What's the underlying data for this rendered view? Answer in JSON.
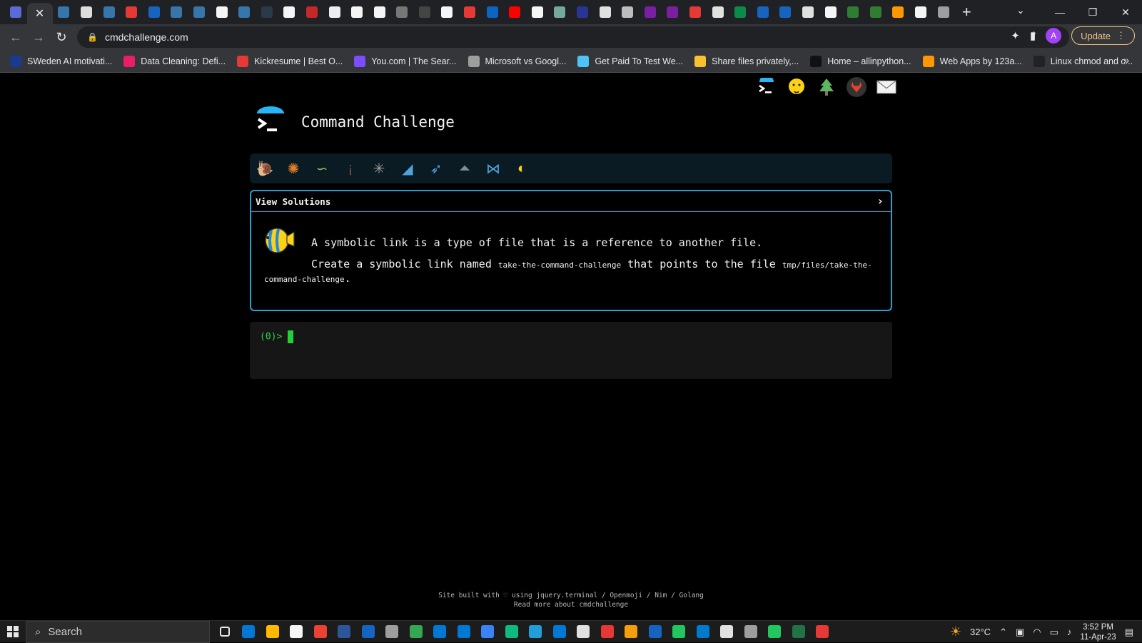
{
  "browser": {
    "url": "cmdchallenge.com",
    "update_label": "Update",
    "avatar_initial": "A",
    "tab_favicons": [
      "#5b6bd6",
      "#3776ab",
      "#dddddd",
      "#3776ab",
      "#e53935",
      "#1565c0",
      "#3776ab",
      "#3776ab",
      "#f5f5f5",
      "#3776ab",
      "#2a3a4a",
      "#f5f5f5",
      "#c62828",
      "#eeeeee",
      "#f5f5f5",
      "#f5f5f5",
      "#777777",
      "#444444",
      "#f5f5f5",
      "#e53935",
      "#0a66c2",
      "#ff0000",
      "#f5f5f5",
      "#74aa9c",
      "#283593",
      "#e0e0e0",
      "#bdbdbd",
      "#7b1fa2",
      "#7b1fa2",
      "#e53935",
      "#e0e0e0",
      "#0b8a4a",
      "#1565c0",
      "#1565c0",
      "#e0e0e0",
      "#f5f5f5",
      "#2e7d32",
      "#2e7d32",
      "#ff9800",
      "#f5f5f5",
      "#9e9e9e"
    ],
    "bookmarks": [
      {
        "label": "SWeden AI motivati...",
        "color": "#1a3a8f"
      },
      {
        "label": "Data Cleaning: Defi...",
        "color": "#e91e63"
      },
      {
        "label": "Kickresume | Best O...",
        "color": "#e53935"
      },
      {
        "label": "You.com | The Sear...",
        "color": "#7c4dff"
      },
      {
        "label": "Microsoft vs Googl...",
        "color": "#9e9e9e"
      },
      {
        "label": "Get Paid To Test We...",
        "color": "#4fc3f7"
      },
      {
        "label": "Share files privately,...",
        "color": "#fbc02d"
      },
      {
        "label": "Home – allinpython...",
        "color": "#111111"
      },
      {
        "label": "Web Apps by 123a...",
        "color": "#ff9800"
      },
      {
        "label": "Linux chmod and c...",
        "color": "#222222"
      }
    ]
  },
  "page": {
    "title": "Command Challenge",
    "view_solutions_label": "View Solutions",
    "challenge_line1": "A symbolic link is a type of file that is a reference to another file.",
    "challenge_line2_a": "Create a symbolic link named",
    "challenge_code1": "take-the-command-challenge",
    "challenge_line2_b": "that points to the file",
    "challenge_code2": "tmp/files/take-the-command-challenge",
    "challenge_line2_end": ".",
    "prompt": "(0)>",
    "footer_line1": "Site built with ♡ using jquery.terminal / Openmoji / Nim / Golang",
    "footer_line2": "Read more about cmdchallenge",
    "level_icons": [
      "snail-icon",
      "butterfly-icon",
      "caterpillar-icon",
      "ant-icon",
      "web-icon",
      "whale-icon",
      "dolphin-icon",
      "shark-icon",
      "fish-icon",
      "tropical-fish-icon"
    ]
  },
  "taskbar": {
    "search_placeholder": "Search",
    "temperature": "32°C",
    "time": "3:52 PM",
    "date": "11-Apr-23",
    "app_colors": [
      "#0078d4",
      "#ffb900",
      "#f5f5f5",
      "#ea4335",
      "#2b579a",
      "#1565c0",
      "#9e9e9e",
      "#34a853",
      "#0078d4",
      "#0078d4",
      "#3b82f6",
      "#10b981",
      "#229ed9",
      "#0078d4",
      "#e0e0e0",
      "#e53935",
      "#f59e0b",
      "#1565c0",
      "#22c55e",
      "#007acc",
      "#e0e0e0",
      "#9e9e9e",
      "#22c55e",
      "#217346",
      "#e53935"
    ]
  }
}
